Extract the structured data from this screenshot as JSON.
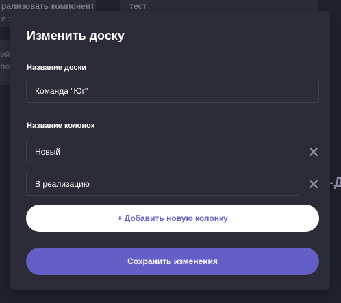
{
  "colors": {
    "background": "#20212c",
    "modal": "#2b2c37",
    "accent": "#635fc7",
    "text": "#ffffff",
    "muted": "#828fa3"
  },
  "background_board": {
    "card1_line1": "рализовать компонент",
    "card1_line2": "е за",
    "card2_line1": "тест",
    "card3_line1": "ойн",
    "card3_line2": "пол",
    "side_heading": "-Д"
  },
  "modal": {
    "title": "Изменить доску",
    "board_name_label": "Название доски",
    "board_name_value": "Команда \"Юг\"",
    "columns_label": "Название колонок",
    "columns": [
      {
        "value": "Новый",
        "remove_icon": "close-icon"
      },
      {
        "value": "В реализацию",
        "remove_icon": "close-icon"
      }
    ],
    "add_column_label": "+ Добавить новую колонку",
    "save_label": "Сохранить изменения"
  }
}
